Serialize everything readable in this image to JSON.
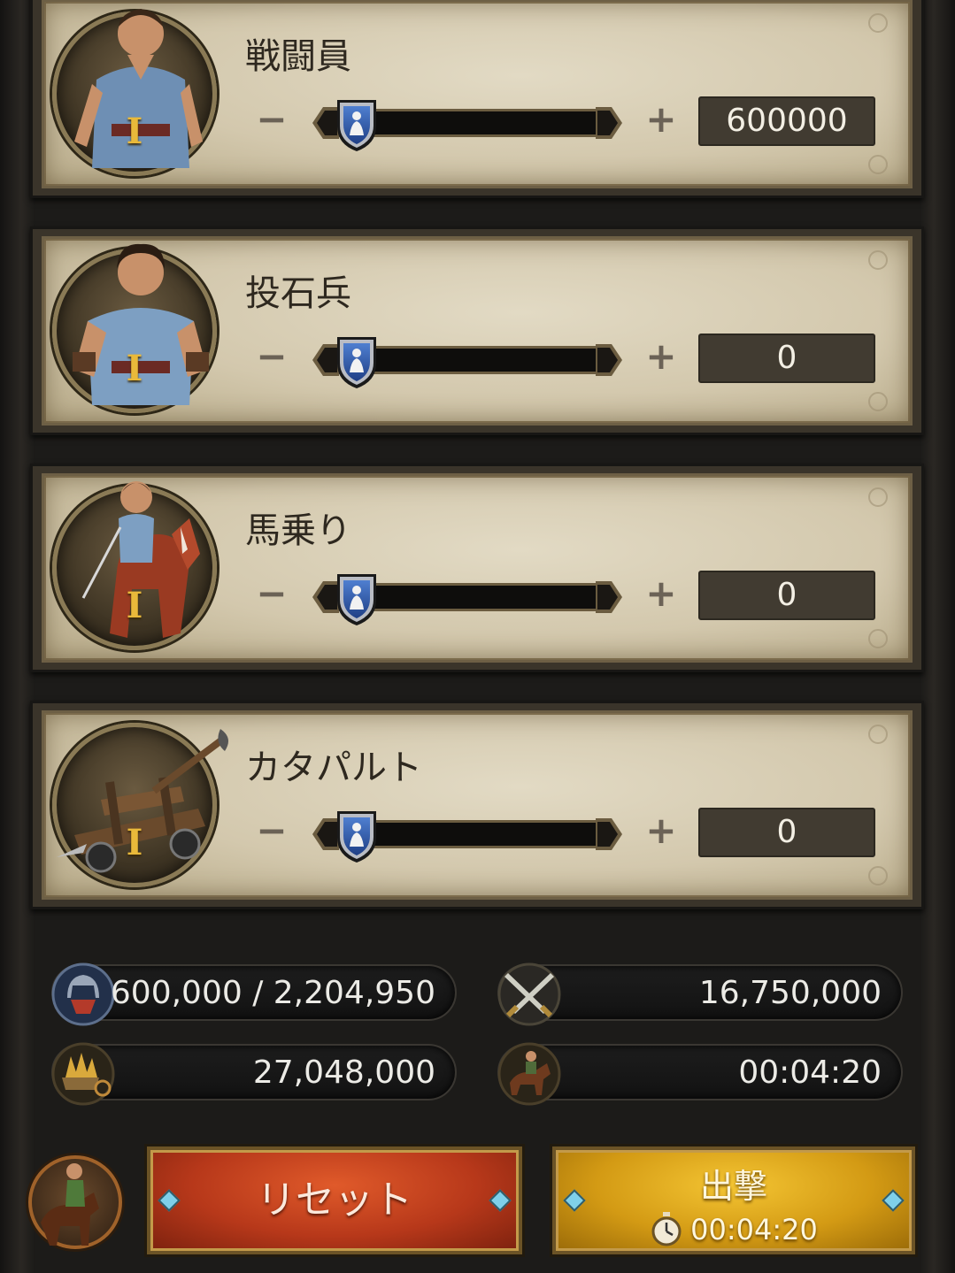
{
  "units": [
    {
      "name": "戦闘員",
      "tier": "I",
      "quantity": "600000",
      "icon": "fighter-portrait-icon",
      "minus": "−",
      "plus": "+"
    },
    {
      "name": "投石兵",
      "tier": "I",
      "quantity": "0",
      "icon": "slinger-portrait-icon",
      "minus": "−",
      "plus": "+"
    },
    {
      "name": "馬乗り",
      "tier": "I",
      "quantity": "0",
      "icon": "rider-portrait-icon",
      "minus": "−",
      "plus": "+"
    },
    {
      "name": "カタパルト",
      "tier": "I",
      "quantity": "0",
      "icon": "catapult-portrait-icon",
      "minus": "−",
      "plus": "+"
    }
  ],
  "stats": {
    "troops": "600,000 / 2,204,950",
    "attack_power": "16,750,000",
    "load": "27,048,000",
    "march_time": "00:04:20"
  },
  "buttons": {
    "reset": "リセット",
    "attack": "出撃",
    "attack_time": "00:04:20"
  },
  "colors": {
    "reset": "#b7381a",
    "attack": "#d39a14",
    "parchment": "#d3c8ad",
    "tier_gold": "#e9b93a"
  }
}
